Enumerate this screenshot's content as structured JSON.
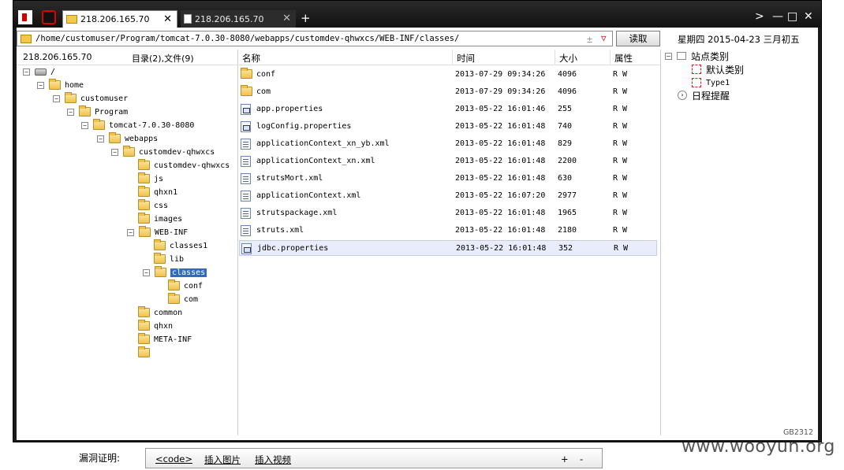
{
  "tabs": [
    {
      "label": "218.206.165.70",
      "active": true
    },
    {
      "label": "218.206.165.70",
      "active": false
    }
  ],
  "window_controls": {
    "chevron": ">",
    "minimize": "—",
    "maximize": "□",
    "close": "✕",
    "new_tab": "+",
    "tab_close": "✕"
  },
  "address": {
    "path": "/home/customuser/Program/tomcat-7.0.30-8080/webapps/customdev-qhwxcs/WEB-INF/classes/",
    "plus": "±",
    "dropdown": "▽",
    "read_button": "读取"
  },
  "date_text": "星期四 2015-04-23 三月初五",
  "left_panel": {
    "ip": "218.206.165.70",
    "counts": "目录(2),文件(9)",
    "tree": [
      {
        "label": "/",
        "expander": "−"
      },
      {
        "label": "home",
        "expander": "−"
      },
      {
        "label": "customuser",
        "expander": "−"
      },
      {
        "label": "Program",
        "expander": "−"
      },
      {
        "label": "tomcat-7.0.30-8080",
        "expander": "−"
      },
      {
        "label": "webapps",
        "expander": "−"
      },
      {
        "label": "customdev-qhwxcs",
        "expander": "−"
      },
      {
        "label": "customdev-qhwxcs",
        "expander": ""
      },
      {
        "label": "js",
        "expander": ""
      },
      {
        "label": "qhxn1",
        "expander": ""
      },
      {
        "label": "css",
        "expander": ""
      },
      {
        "label": "images",
        "expander": ""
      },
      {
        "label": "WEB-INF",
        "expander": "−"
      },
      {
        "label": "classes1",
        "expander": ""
      },
      {
        "label": "lib",
        "expander": ""
      },
      {
        "label": "classes",
        "expander": "−",
        "selected": true
      },
      {
        "label": "conf",
        "expander": ""
      },
      {
        "label": "com",
        "expander": ""
      },
      {
        "label": "common",
        "expander": ""
      },
      {
        "label": "qhxn",
        "expander": ""
      },
      {
        "label": "META-INF",
        "expander": ""
      },
      {
        "label": "",
        "expander": ""
      }
    ]
  },
  "file_list": {
    "columns": [
      "名称",
      "时间",
      "大小",
      "属性"
    ],
    "rows": [
      {
        "type": "folder",
        "name": "conf",
        "time": "2013-07-29 09:34:26",
        "size": "4096",
        "attr": "R W"
      },
      {
        "type": "folder",
        "name": "com",
        "time": "2013-07-29 09:34:26",
        "size": "4096",
        "attr": "R W"
      },
      {
        "type": "prop",
        "name": "app.properties",
        "time": "2013-05-22 16:01:46",
        "size": "255",
        "attr": "R W"
      },
      {
        "type": "prop",
        "name": "logConfig.properties",
        "time": "2013-05-22 16:01:48",
        "size": "740",
        "attr": "R W"
      },
      {
        "type": "xml",
        "name": "applicationContext_xn_yb.xml",
        "time": "2013-05-22 16:01:48",
        "size": "829",
        "attr": "R W"
      },
      {
        "type": "xml",
        "name": "applicationContext_xn.xml",
        "time": "2013-05-22 16:01:48",
        "size": "2200",
        "attr": "R W"
      },
      {
        "type": "xml",
        "name": "strutsMort.xml",
        "time": "2013-05-22 16:01:48",
        "size": "630",
        "attr": "R W"
      },
      {
        "type": "xml",
        "name": "applicationContext.xml",
        "time": "2013-05-22 16:07:20",
        "size": "2977",
        "attr": "R W"
      },
      {
        "type": "xml",
        "name": "strutspackage.xml",
        "time": "2013-05-22 16:01:48",
        "size": "1965",
        "attr": "R W"
      },
      {
        "type": "xml",
        "name": "struts.xml",
        "time": "2013-05-22 16:01:48",
        "size": "2180",
        "attr": "R W"
      },
      {
        "type": "prop",
        "name": "jdbc.properties",
        "time": "2013-05-22 16:01:48",
        "size": "352",
        "attr": "R W",
        "selected": true
      }
    ]
  },
  "right_panel": {
    "root": "站点类别",
    "root_expander": "−",
    "categories": [
      "默认类别",
      "Type1"
    ],
    "reminders": "日程提醒"
  },
  "encoding": "GB2312",
  "below": {
    "label": "漏洞证明:",
    "toolbar": {
      "code": "<code>",
      "insert_image": "插入图片",
      "insert_video": "插入视频",
      "plus": "+",
      "minus": "-"
    }
  },
  "watermark": "www.wooyun.org"
}
